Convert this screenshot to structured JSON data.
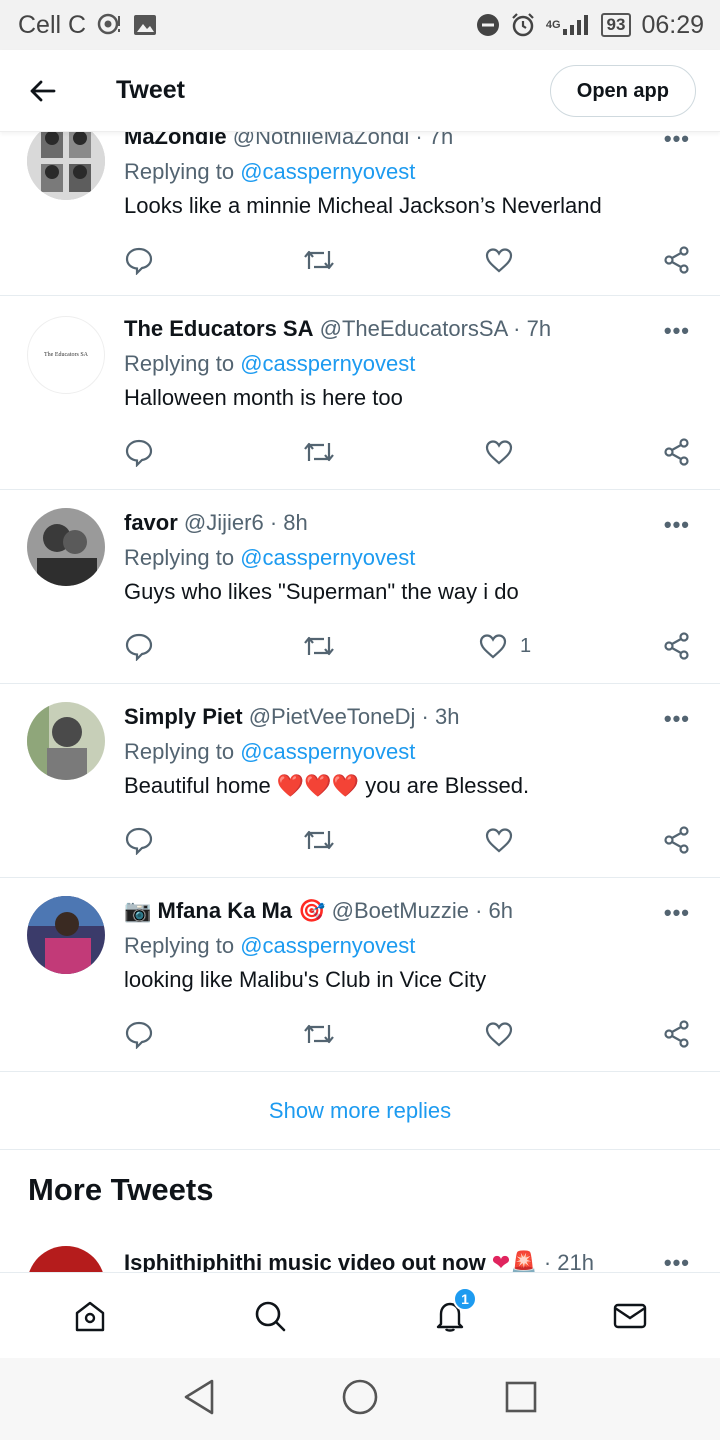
{
  "status_bar": {
    "carrier": "Cell C",
    "network": "4G",
    "battery": "93",
    "time": "06:29"
  },
  "header": {
    "title": "Tweet",
    "open_app_label": "Open app"
  },
  "replying_label": "Replying to",
  "tweets": [
    {
      "name": "MaZondie",
      "handle": "@NothileMaZondi",
      "time": "7h",
      "mention": "@casspernyovest",
      "text": "Looks like a minnie Micheal Jackson’s Neverland",
      "likes": ""
    },
    {
      "name": "The Educators SA",
      "handle": "@TheEducatorsSA",
      "time": "7h",
      "mention": "@casspernyovest",
      "text": "Halloween month is here too",
      "likes": "",
      "avatar_text": "The Educators SA"
    },
    {
      "name": "favor",
      "handle": "@Jijier6",
      "time": "8h",
      "mention": "@casspernyovest",
      "text": "Guys who likes \"Superman\" the way i do",
      "likes": "1"
    },
    {
      "name": "Simply Piet",
      "handle": "@PietVeeToneDj",
      "time": "3h",
      "mention": "@casspernyovest",
      "text_before": "Beautiful home",
      "emoji": "❤️❤️❤️",
      "text_after": "you are Blessed.",
      "likes": ""
    },
    {
      "name": "Mfana Ka Ma",
      "name_prefix_emoji": "📷",
      "name_suffix_emoji": "🎯",
      "handle": "@BoetMuzzie",
      "time": "6h",
      "mention": "@casspernyovest",
      "text": "looking like Malibu's Club in Vice City",
      "likes": ""
    }
  ],
  "show_more_replies": "Show more replies",
  "more_tweets": {
    "title": "More Tweets",
    "first_item": {
      "text": "Isphithiphithi music video out now",
      "emoji": "❤🚨",
      "time": "21h"
    }
  },
  "bottom_nav": {
    "notification_count": "1"
  },
  "icons": {
    "back": "arrow-left-icon",
    "reply": "reply-icon",
    "retweet": "retweet-icon",
    "like": "heart-icon",
    "share": "share-icon",
    "more": "more-icon",
    "home": "home-icon",
    "search": "search-icon",
    "notifications": "bell-icon",
    "messages": "mail-icon"
  },
  "colors": {
    "accent": "#1d9bf0",
    "text": "#0f1419",
    "secondary": "#536471"
  }
}
